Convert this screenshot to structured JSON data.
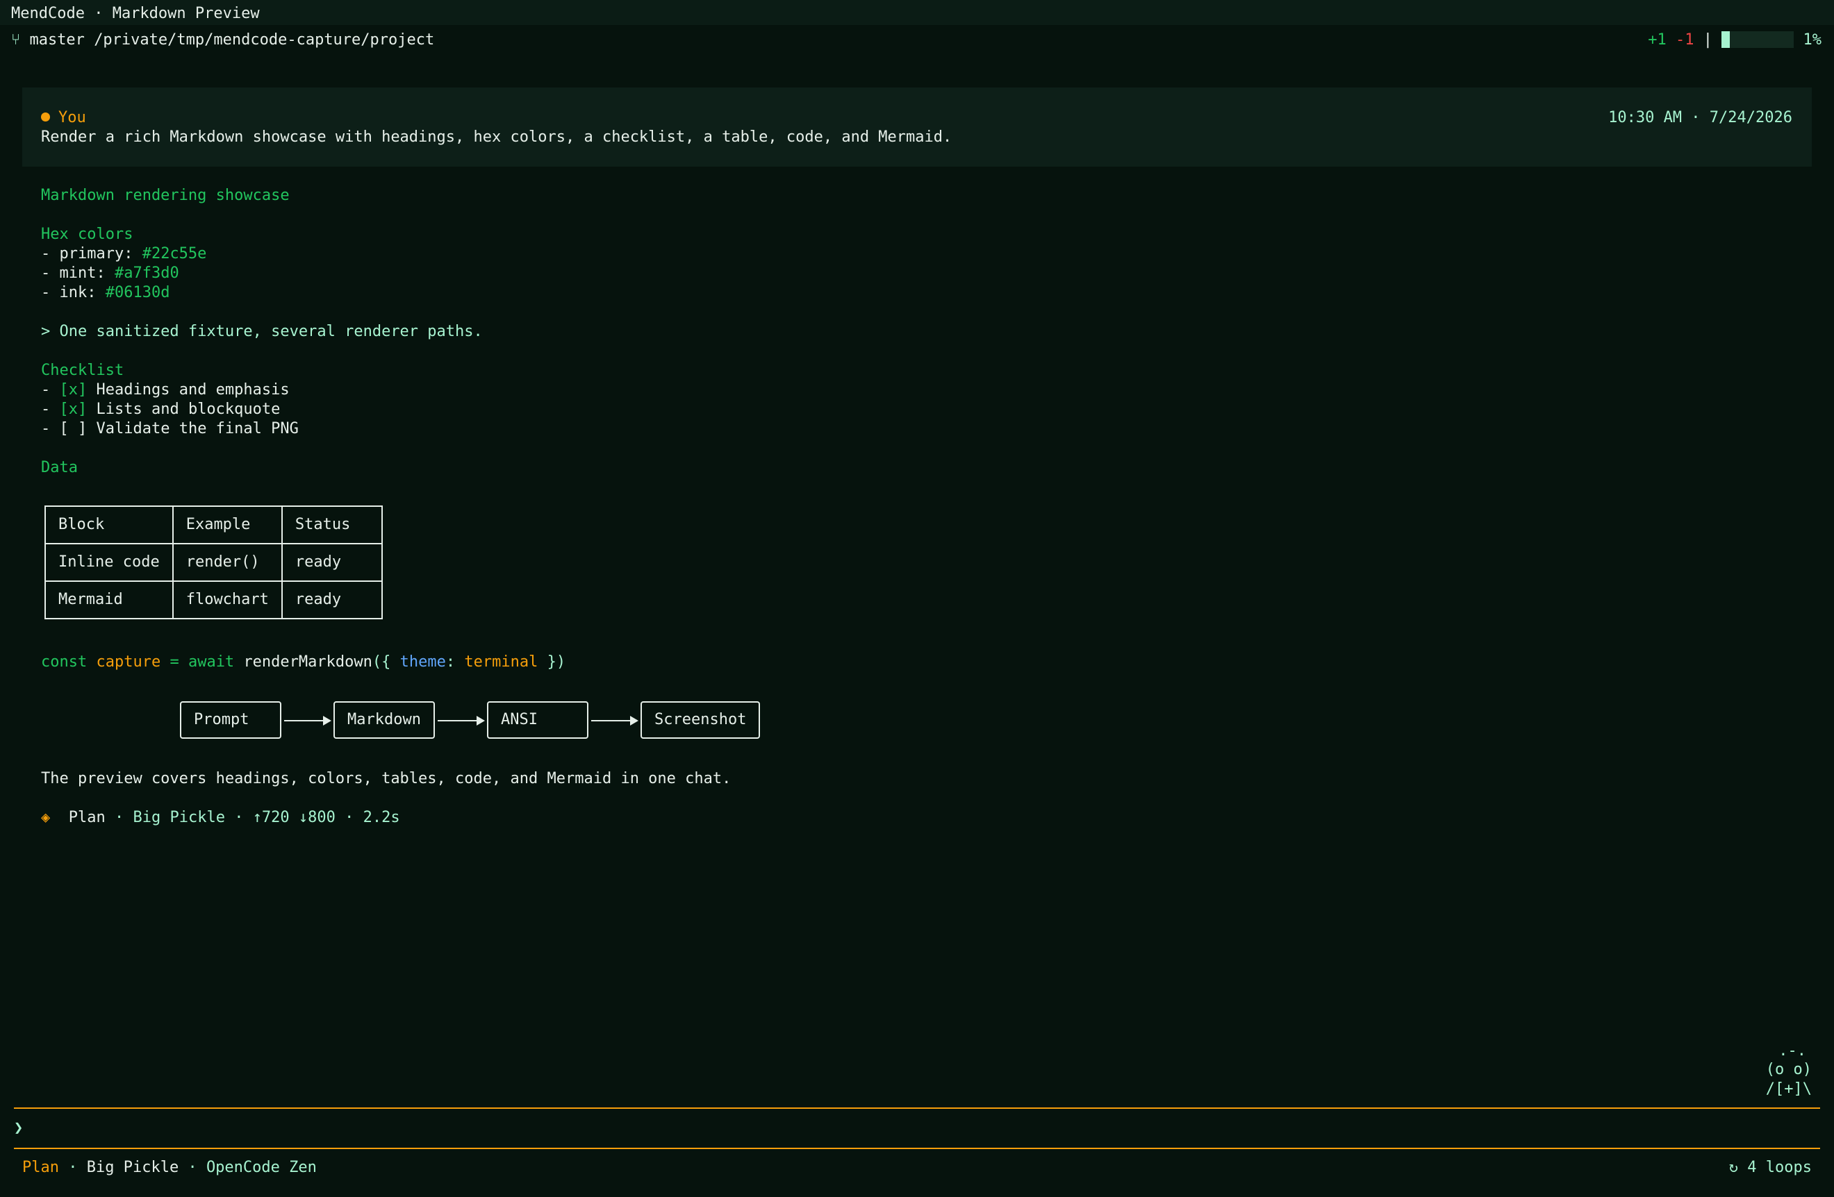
{
  "window": {
    "title": "MendCode · Markdown Preview"
  },
  "status_bar": {
    "branch_icon": "git-branch-icon",
    "branch": "master",
    "path": "/private/tmp/mendcode-capture/project",
    "diff_added": "+1",
    "diff_removed": "-1",
    "separator": "|",
    "context_used": 0.01,
    "context_percent": "1%"
  },
  "user_message": {
    "author": "You",
    "timestamp": "10:30 AM · 7/24/2026",
    "text": "Render a rich Markdown showcase with headings, hex colors, a checklist, a table, code, and Mermaid."
  },
  "assistant": {
    "title": "Markdown rendering showcase",
    "hex_heading": "Hex colors",
    "hex_colors": [
      {
        "prefix": "- primary: ",
        "value": "#22c55e"
      },
      {
        "prefix": "- mint: ",
        "value": "#a7f3d0"
      },
      {
        "prefix": "- ink: ",
        "value": "#06130d"
      }
    ],
    "quote": "> One sanitized fixture, several renderer paths.",
    "checklist_heading": "Checklist",
    "checklist": [
      {
        "bullet": "- ",
        "mark": "[x]",
        "label": " Headings and emphasis"
      },
      {
        "bullet": "- ",
        "mark": "[x]",
        "label": " Lists and blockquote"
      },
      {
        "bullet": "- ",
        "mark": "[ ]",
        "label": " Validate the final PNG"
      }
    ],
    "data_heading": "Data",
    "table": {
      "headers": [
        "Block",
        "Example",
        "Status"
      ],
      "rows": [
        [
          "Inline code",
          "render()",
          "ready"
        ],
        [
          "Mermaid",
          "flowchart",
          "ready"
        ]
      ]
    },
    "code": {
      "kw_const": "const",
      "var_name": "capture",
      "op_eq": "=",
      "kw_await": "await",
      "func": "renderMarkdown",
      "open": "({",
      "key": "theme",
      "colon": ":",
      "value": "terminal",
      "close": "})"
    },
    "flowchart": [
      "Prompt",
      "Markdown",
      "ANSI",
      "Screenshot"
    ],
    "summary": "The preview covers headings, colors, tables, code, and Mermaid in one chat.",
    "meta": {
      "icon": "diamond-icon",
      "mode": "Plan",
      "sep": "·",
      "model": "Big Pickle",
      "tokens": "↑720 ↓800",
      "duration": "2.2s"
    }
  },
  "mascot": {
    "line1": ".-.",
    "line2": "(o o)",
    "line3": "/[+]\\"
  },
  "input": {
    "prompt": "❯",
    "value": ""
  },
  "footer": {
    "mode": "Plan",
    "sep": "·",
    "model": "Big Pickle",
    "provider": "OpenCode Zen",
    "loops_icon": "loop-icon",
    "loops": "↻ 4 loops"
  },
  "colors": {
    "background": "#06130d",
    "accent_green": "#22c55e",
    "mint": "#a7f3d0",
    "orange": "#f59e0b",
    "red": "#ef4444",
    "blue": "#60a5fa"
  }
}
